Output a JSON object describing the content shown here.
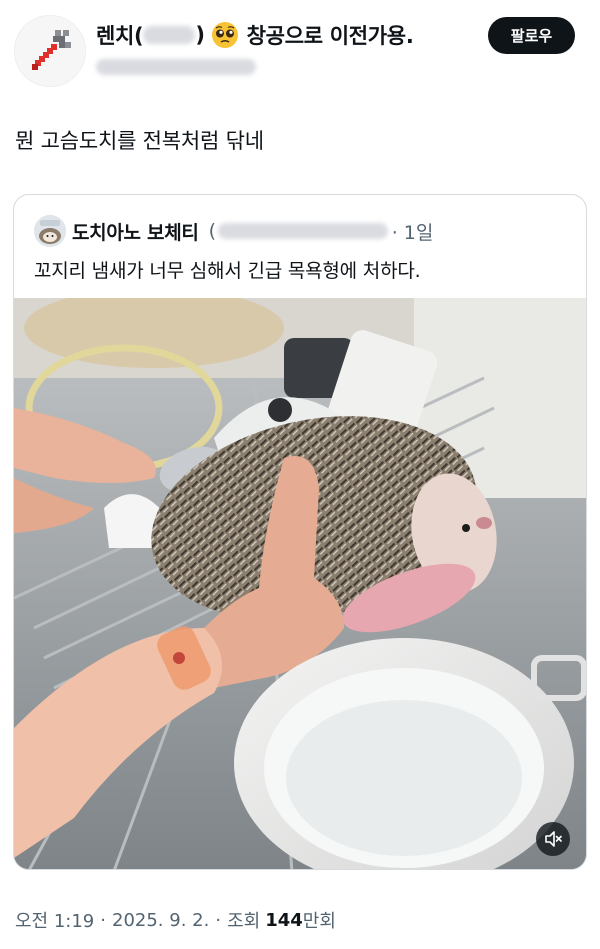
{
  "post": {
    "author": {
      "name_prefix": "렌치(",
      "name_suffix": ")",
      "name_emoji": "pleading-face-icon",
      "name_tail": "창공으로 이전가용.",
      "avatar_icon": "wrench-icon"
    },
    "follow_label": "팔로우",
    "text": "뭔 고슴도치를 전복처럼 닦네"
  },
  "quote": {
    "author": {
      "name": "도치아노 보체티",
      "name_prefix": "(",
      "avatar_icon": "hedgehog-avatar-icon"
    },
    "time": "· 1일",
    "text": "꼬지리 냄새가 너무 심해서 긴급 목욕형에 처하다.",
    "media": {
      "kind": "video",
      "mute_icon": "speaker-muted-icon"
    }
  },
  "meta": {
    "time": "오전 1:19",
    "dot1": "·",
    "date": "2025. 9. 2.",
    "dot2": "·",
    "views_label": "조회",
    "views_value": "144",
    "views_unit": "만회"
  },
  "colors": {
    "text": "#0f1419",
    "secondary": "#536471",
    "follow_bg": "#0f1419",
    "border": "#d6dbdf"
  }
}
